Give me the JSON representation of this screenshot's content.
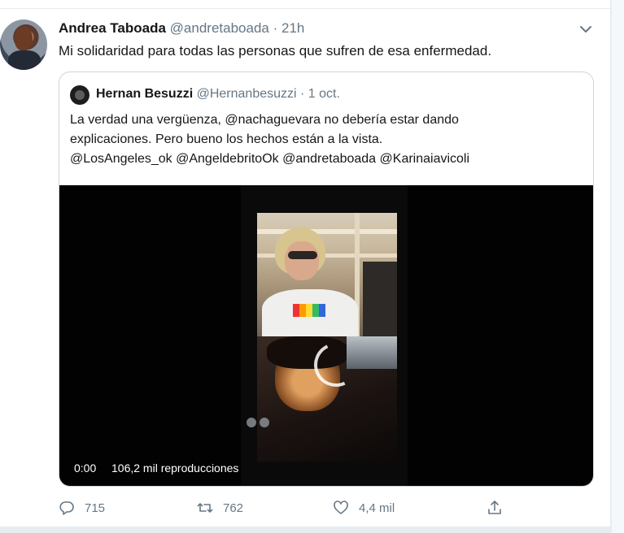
{
  "tweet": {
    "author_name": "Andrea Taboada",
    "author_handle": "@andretaboada",
    "separator": "·",
    "time": "21h",
    "text": "Mi solidaridad para todas las personas que sufren de esa enfermedad."
  },
  "quoted_tweet": {
    "author_name": "Hernan Besuzzi",
    "author_handle": "@Hernanbesuzzi",
    "separator": "·",
    "date": "1 oct.",
    "text_lines": [
      "La verdad una vergüenza, @nachaguevara no debería estar dando",
      "explicaciones. Pero bueno los hechos están a la vista.",
      "@LosAngeles_ok @AngeldebritoOk @andretaboada @Karinaiavicoli"
    ],
    "video": {
      "time": "0:00",
      "views": "106,2 mil reproducciones"
    }
  },
  "actions": {
    "reply_count": "715",
    "retweet_count": "762",
    "like_count": "4,4 mil"
  },
  "icons": {
    "more": "chevron-down-icon",
    "reply": "reply-icon",
    "retweet": "retweet-icon",
    "like": "heart-icon",
    "share": "share-icon"
  },
  "colors": {
    "text_primary": "#14171a",
    "text_secondary": "#657786",
    "border": "#ccd6dd"
  }
}
